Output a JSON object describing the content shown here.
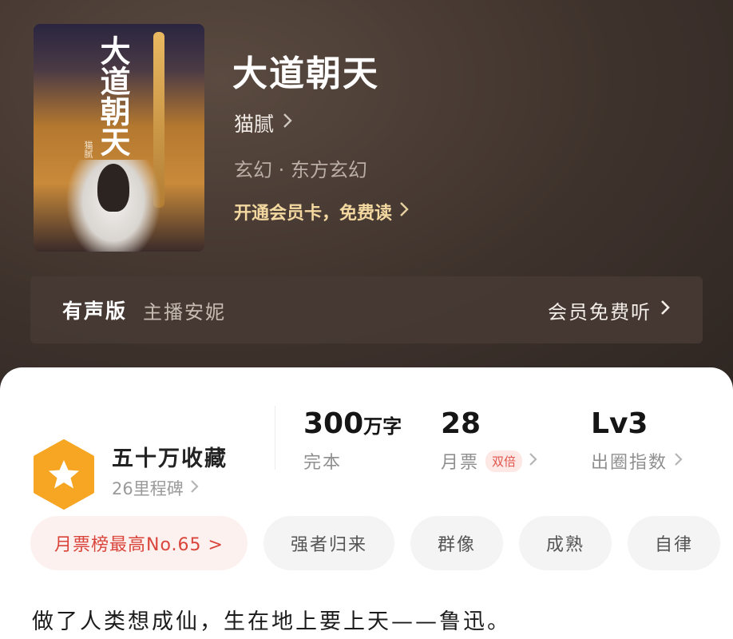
{
  "book": {
    "title": "大道朝天",
    "cover_title": "大道朝天",
    "cover_author": "猫腻",
    "author": "猫腻",
    "genre": "玄幻 · 东方玄幻",
    "vip_cta": "开通会员卡，免费读"
  },
  "audio": {
    "label": "有声版",
    "narrator": "主播安妮",
    "cta": "会员免费听"
  },
  "collection": {
    "title": "五十万收藏",
    "milestone": "26里程碑",
    "badge_icon": "star-icon",
    "badge_color": "#F6A623"
  },
  "stats": {
    "words": {
      "value": "300",
      "unit": "万字",
      "label": "完本"
    },
    "monthly_votes": {
      "value": "28",
      "label": "月票",
      "tag": "双倍"
    },
    "index": {
      "value": "Lv3",
      "label": "出圈指数"
    }
  },
  "tags": [
    "月票榜最高No.65 >",
    "强者归来",
    "群像",
    "成熟",
    "自律"
  ],
  "quote": "做了人类想成仙，生在地上要上天——鲁迅。",
  "colors": {
    "accent_gold": "#F3D8A0",
    "rank_red": "#D9453B",
    "hero_bg": "#3E322C"
  }
}
